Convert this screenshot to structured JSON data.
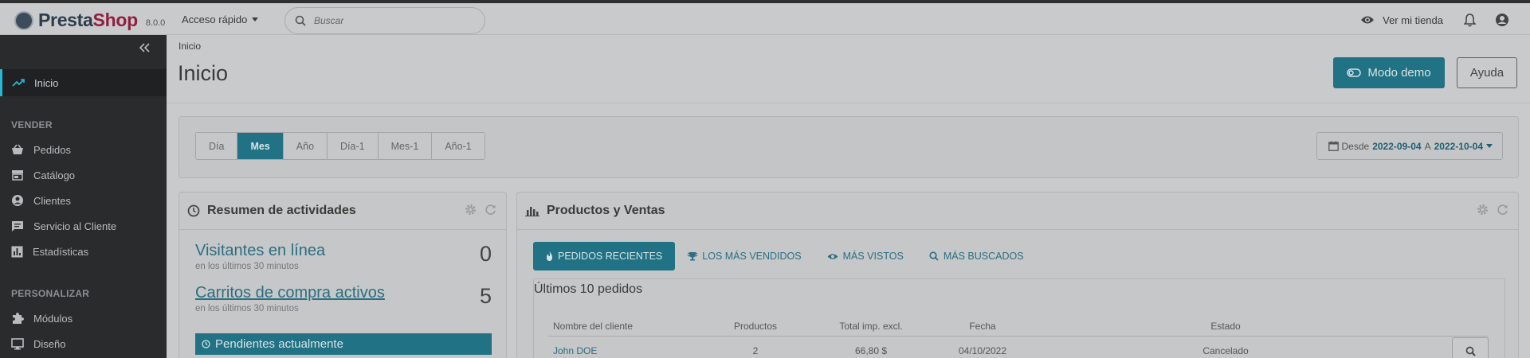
{
  "brand": {
    "name_part1": "Presta",
    "name_part2": "Shop",
    "version": "8.0.0"
  },
  "topbar": {
    "quick_access": "Acceso rápido",
    "search_placeholder": "Buscar",
    "view_shop": "Ver mi tienda"
  },
  "sidebar": {
    "items": [
      {
        "label": "Inicio",
        "icon": "trending-up-icon",
        "active": true
      },
      {
        "label": "Pedidos",
        "icon": "basket-icon"
      },
      {
        "label": "Catálogo",
        "icon": "store-icon"
      },
      {
        "label": "Clientes",
        "icon": "account-circle-icon"
      },
      {
        "label": "Servicio al Cliente",
        "icon": "chat-icon"
      },
      {
        "label": "Estadísticas",
        "icon": "bar-chart-icon"
      },
      {
        "label": "Módulos",
        "icon": "puzzle-icon"
      },
      {
        "label": "Diseño",
        "icon": "desktop-icon"
      }
    ],
    "sections": [
      "VENDER",
      "PERSONALIZAR"
    ]
  },
  "header": {
    "breadcrumb": "Inicio",
    "title": "Inicio",
    "demo_button": "Modo demo",
    "help_button": "Ayuda"
  },
  "period": {
    "tabs": [
      "Día",
      "Mes",
      "Año",
      "Día-1",
      "Mes-1",
      "Año-1"
    ],
    "active_tab": "Mes",
    "range_from_label": "Desde",
    "range_from": "2022-09-04",
    "range_to_label": "A",
    "range_to": "2022-10-04"
  },
  "activity": {
    "title": "Resumen de actividades",
    "visitors_label": "Visitantes en línea",
    "visitors_sub": "en los últimos 30 minutos",
    "visitors_value": "0",
    "carts_label": "Carritos de compra activos",
    "carts_sub": "en los últimos 30 minutos",
    "carts_value": "5",
    "pending_label": "Pendientes actualmente"
  },
  "products": {
    "title": "Productos y Ventas",
    "tabs": [
      "PEDIDOS RECIENTES",
      "LOS MÁS VENDIDOS",
      "MÁS VISTOS",
      "MÁS BUSCADOS"
    ],
    "orders_title": "Últimos 10 pedidos",
    "columns": [
      "Nombre del cliente",
      "Productos",
      "Total imp. excl.",
      "Fecha",
      "Estado"
    ],
    "rows": [
      {
        "customer": "John DOE",
        "products": "2",
        "total": "66,80 $",
        "date": "04/10/2022",
        "status": "Cancelado"
      }
    ]
  },
  "colors": {
    "accent": "#25b9d7",
    "sidebar_bg": "#2a2b2c"
  }
}
